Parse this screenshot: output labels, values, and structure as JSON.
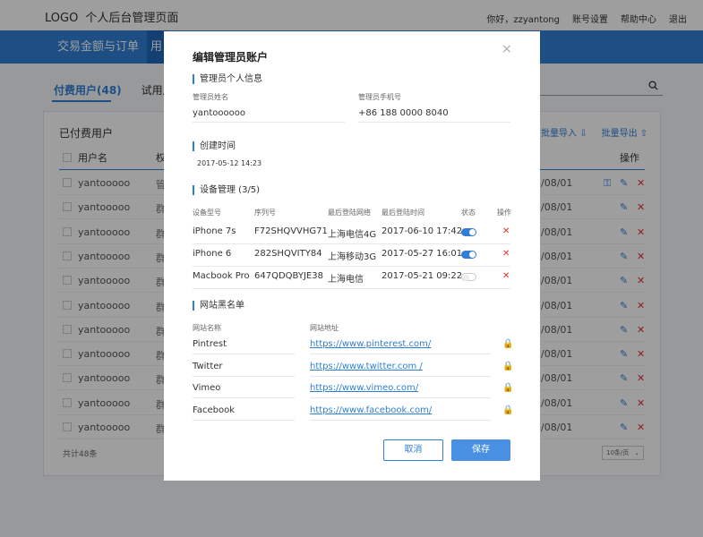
{
  "header": {
    "logo": "LOGO",
    "subtitle": "个人后台管理页面",
    "greeting": "你好，zzyantong",
    "account_settings": "账号设置",
    "help": "帮助中心",
    "logout": "退出"
  },
  "nav": {
    "items": [
      "交易金额与订单",
      "用"
    ]
  },
  "tabs": {
    "paid": "付费用户(48)",
    "trial": "试用用户"
  },
  "panel": {
    "title": "已付费用户",
    "bulk_import": "批量导入",
    "bulk_export": "批量导出",
    "col_user": "用户名",
    "col_perm": "权",
    "col_ops": "操作",
    "rows": [
      {
        "name": "yantooooo",
        "type": "管",
        "date": "/08/01"
      },
      {
        "name": "yantooooo",
        "type": "群",
        "date": "/08/01"
      },
      {
        "name": "yantooooo",
        "type": "群",
        "date": "/08/01"
      },
      {
        "name": "yantooooo",
        "type": "群",
        "date": "/08/01"
      },
      {
        "name": "yantooooo",
        "type": "群",
        "date": "/08/01"
      },
      {
        "name": "yantooooo",
        "type": "群",
        "date": "/08/01"
      },
      {
        "name": "yantooooo",
        "type": "群",
        "date": "/08/01"
      },
      {
        "name": "yantooooo",
        "type": "群",
        "date": "/08/01"
      },
      {
        "name": "yantooooo",
        "type": "群",
        "date": "/08/01"
      },
      {
        "name": "yantooooo",
        "type": "群",
        "date": "/08/01"
      },
      {
        "name": "yantooooo",
        "type": "群",
        "date": "/08/01"
      }
    ],
    "total": "共计48条",
    "page_size": "10条/页"
  },
  "modal": {
    "title": "编辑管理员账户",
    "personal_section": "管理员个人信息",
    "name_label": "管理员姓名",
    "name_value": "yantoooooo",
    "phone_label": "管理员手机号",
    "phone_value": "+86 188 0000 8040",
    "created_section": "创建时间",
    "created_value": "2017-05-12 14:23",
    "device_section": "设备管理 (3/5)",
    "device_headers": [
      "设备型号",
      "序列号",
      "最后登陆网络",
      "最后登陆时间",
      "状态",
      "操作"
    ],
    "devices": [
      {
        "model": "iPhone 7s",
        "serial": "F72SHQVVHG71",
        "network": "上海电信4G",
        "time": "2017-06-10 17:42",
        "on": true
      },
      {
        "model": "iPhone 6",
        "serial": "282SHQVITY84",
        "network": "上海移动3G",
        "time": "2017-05-27 16:01",
        "on": true
      },
      {
        "model": "Macbook Pro",
        "serial": "647QDQBYJE38",
        "network": "上海电信",
        "time": "2017-05-21 09:22",
        "on": false
      }
    ],
    "blacklist_section": "网站黑名单",
    "site_name_header": "网站名称",
    "site_url_header": "网站地址",
    "sites": [
      {
        "name": "Pintrest",
        "url": "https://www.pinterest.com/"
      },
      {
        "name": "Twitter",
        "url": "https://www.twitter.com /"
      },
      {
        "name": "Vimeo",
        "url": "https://www.vimeo.com/"
      },
      {
        "name": "Facebook",
        "url": "https://www.facebook.com/"
      }
    ],
    "cancel": "取消",
    "save": "保存"
  }
}
